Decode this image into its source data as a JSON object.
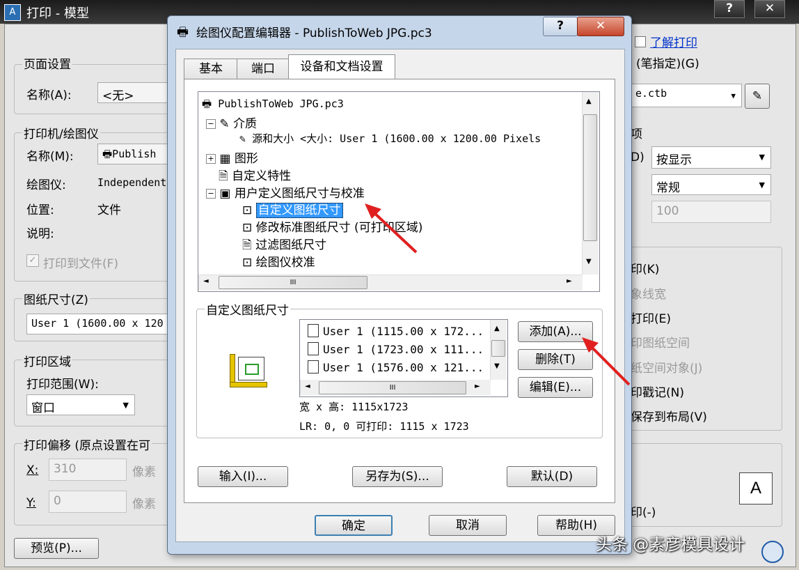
{
  "back_window": {
    "title": "打印 - 模型",
    "app_icon": "A",
    "help_btn": "?",
    "close_btn": "✕",
    "learn_link": "了解打印",
    "page_setup": {
      "group": "页面设置",
      "name_label": "名称(A):",
      "name_value": "<无>"
    },
    "printer": {
      "group": "打印机/绘图仪",
      "name_label": "名称(M):",
      "name_value": "Publish",
      "plotter_label": "绘图仪:",
      "plotter_value": "Independent",
      "location_label": "位置:",
      "location_value": "文件",
      "desc_label": "说明:",
      "print_to_file": "打印到文件(F)"
    },
    "paper_size": {
      "group": "图纸尺寸(Z)",
      "value": "User 1 (1600.00 x 120"
    },
    "plot_area": {
      "group": "打印区域",
      "range_label": "打印范围(W):",
      "range_value": "窗口"
    },
    "plot_offset": {
      "group": "打印偏移 (原点设置在可",
      "x_label": "X:",
      "x_value": "310",
      "y_label": "Y:",
      "y_value": "0",
      "unit": "像素"
    },
    "preview_btn": "预览(P)...",
    "right": {
      "pen_label": "(笔指定)(G)",
      "ctb_value": "e.ctb",
      "shade_heading": "项",
      "shade_prefix": "D)",
      "shade_value": "按显示",
      "quality_value": "常规",
      "dpi_value": "100",
      "options": [
        "印(K)",
        "象线宽",
        "打印(E)",
        "印图纸空间",
        "纸空间对象(J)",
        "印戳记(N)",
        "保存到布局(V)"
      ],
      "orient_label": "印(-)",
      "orient_icon": "A"
    }
  },
  "dialog": {
    "title": "绘图仪配置编辑器 - PublishToWeb JPG.pc3",
    "help_btn": "?",
    "close_btn": "✕",
    "tabs": [
      "基本",
      "端口",
      "设备和文档设置"
    ],
    "tree": [
      {
        "label": "PublishToWeb JPG.pc3",
        "indent": 0,
        "expander": ""
      },
      {
        "label": "介质",
        "indent": 1,
        "expander": "−"
      },
      {
        "label": "源和大小 <大小: User 1 (1600.00 x 1200.00 Pixels",
        "indent": 2,
        "expander": ""
      },
      {
        "label": "图形",
        "indent": 1,
        "expander": "+"
      },
      {
        "label": "自定义特性",
        "indent": 1,
        "expander": ""
      },
      {
        "label": "用户定义图纸尺寸与校准",
        "indent": 1,
        "expander": "−"
      },
      {
        "label": "自定义图纸尺寸",
        "indent": 2,
        "expander": "",
        "selected": true
      },
      {
        "label": "修改标准图纸尺寸 (可打印区域)",
        "indent": 2,
        "expander": ""
      },
      {
        "label": "过滤图纸尺寸",
        "indent": 2,
        "expander": ""
      },
      {
        "label": "绘图仪校准",
        "indent": 2,
        "expander": ""
      }
    ],
    "scroll_mark": "III",
    "custom_group": "自定义图纸尺寸",
    "sizes": [
      "User 1 (1115.00 x 172...",
      "User 1 (1723.00 x 111...",
      "User 1 (1576.00 x 121..."
    ],
    "buttons": {
      "add": "添加(A)...",
      "delete": "删除(T)",
      "edit": "编辑(E)..."
    },
    "wh_line": "宽 x 高: 1115x1723",
    "lr_line": "LR: 0, 0  可打印: 1115 x 1723",
    "bottom": {
      "import": "输入(I)...",
      "save_as": "另存为(S)...",
      "default": "默认(D)"
    },
    "footer": {
      "ok": "确定",
      "cancel": "取消",
      "help": "帮助(H)"
    }
  },
  "watermark": "头条 @素彦模具设计",
  "colors": {
    "selection": "#3399ff",
    "arrow": "#e02020"
  }
}
